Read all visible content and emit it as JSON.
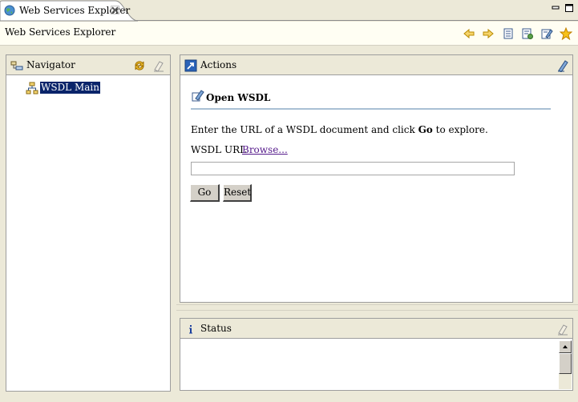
{
  "tab": {
    "title": "Web Services Explorer",
    "icon": "globe-icon",
    "close_icon": "close-icon"
  },
  "window_controls": [
    "minimize-icon",
    "maximize-icon"
  ],
  "header": {
    "title": "Web Services Explorer",
    "toolbar_icons": [
      "back-arrow-icon",
      "forward-arrow-icon",
      "uddi-page-icon",
      "wsil-page-icon",
      "wsdl-page-icon",
      "favorites-star-icon"
    ]
  },
  "navigator": {
    "label": "Navigator",
    "tools": [
      "refresh-icon",
      "clear-icon"
    ],
    "items": [
      {
        "label": "WSDL Main",
        "icon": "wsdl-tree-icon",
        "selected": true
      }
    ]
  },
  "actions": {
    "label": "Actions",
    "section_title": "Open WSDL",
    "instruction_pre": "Enter the URL of a WSDL document and click ",
    "instruction_bold": "Go",
    "instruction_post": " to explore.",
    "url_label": "WSDL URL",
    "browse_label": "Browse...",
    "url_value": "",
    "go_label": "Go",
    "reset_label": "Reset"
  },
  "status": {
    "label": "Status",
    "text": ""
  },
  "colors": {
    "chrome": "#ece9d8",
    "selection": "#0a246a",
    "link": "#551a8b",
    "rule": "#a9c0d4"
  }
}
